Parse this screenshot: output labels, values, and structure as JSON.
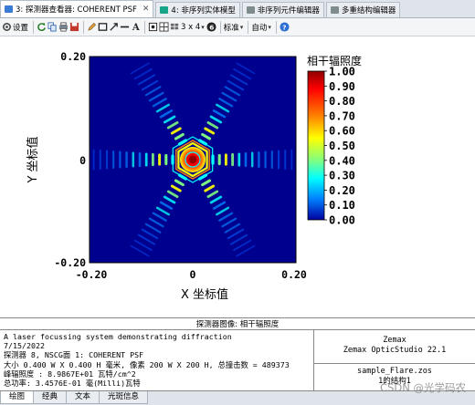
{
  "tabs": [
    {
      "label": "3: 探测器查看器: COHERENT PSF",
      "close": "✕",
      "icon_color": "#3a7bd5",
      "active": true
    },
    {
      "label": "4: 非序列实体模型",
      "icon_color": "#17a589",
      "active": false
    },
    {
      "label": "非序列元件编辑器",
      "icon_color": "#7f8c8d",
      "active": false
    },
    {
      "label": "多重结构编辑器",
      "icon_color": "#7f8c8d",
      "active": false
    }
  ],
  "toolbar": {
    "settings_label": "设置",
    "layout_label": "3 x 4",
    "standard_label": "标准",
    "auto_label": "自动",
    "icons": [
      "settings-icon",
      "refresh-icon",
      "copy-icon",
      "print-icon",
      "save-icon",
      "pencil-icon",
      "rectangle-icon",
      "arrow-icon",
      "line-icon",
      "text-icon",
      "lock-icon",
      "grid-icon",
      "layout-icon",
      "info-icon",
      "help-icon"
    ]
  },
  "chart_data": {
    "type": "heatmap",
    "description_kind": "coherent PSF detector image",
    "xlabel": "X 坐标值",
    "ylabel": "Y 坐标值",
    "x_ticks": [
      "-0.20",
      "0",
      "0.20"
    ],
    "y_ticks": [
      "0.20",
      "0",
      "-0.20"
    ],
    "xlim": [
      -0.2,
      0.2
    ],
    "ylim": [
      -0.2,
      0.2
    ],
    "colorbar": {
      "title": "相干辐照度",
      "ticks": [
        "1.00",
        "0.90",
        "0.80",
        "0.70",
        "0.60",
        "0.50",
        "0.40",
        "0.30",
        "0.20",
        "0.10",
        "0.00"
      ],
      "range": [
        0,
        1
      ]
    },
    "colormap": [
      "#00008f",
      "#0000ff",
      "#0080ff",
      "#00ffff",
      "#80ff80",
      "#ffff00",
      "#ff8000",
      "#ff0000",
      "#8f0000"
    ],
    "spike_directions_deg": [
      0,
      60,
      120,
      180,
      240,
      300
    ]
  },
  "panel": {
    "title": "探测器图像: 相干辐照度",
    "lines": [
      "A laser focussing system demonstrating diffraction",
      "7/15/2022",
      "探测器 8, NSCG面 1: COHERENT PSF",
      "大小 0.400 W X 0.400 H 毫米, 像素 200 W X 200 H, 总撞击数 = 489373",
      "峰辐照度 : 8.9867E+01 瓦特/cm^2",
      "总功率: 3.4576E-01 毫(Milli)瓦特"
    ],
    "company": "Zemax",
    "product": "Zemax OpticStudio 22.1",
    "file": "sample_Flare.zos",
    "config": "1的结构1"
  },
  "bottom_tabs": [
    "绘图",
    "经典",
    "文本",
    "光斑信息"
  ],
  "watermark": "CSDN @光学码农"
}
